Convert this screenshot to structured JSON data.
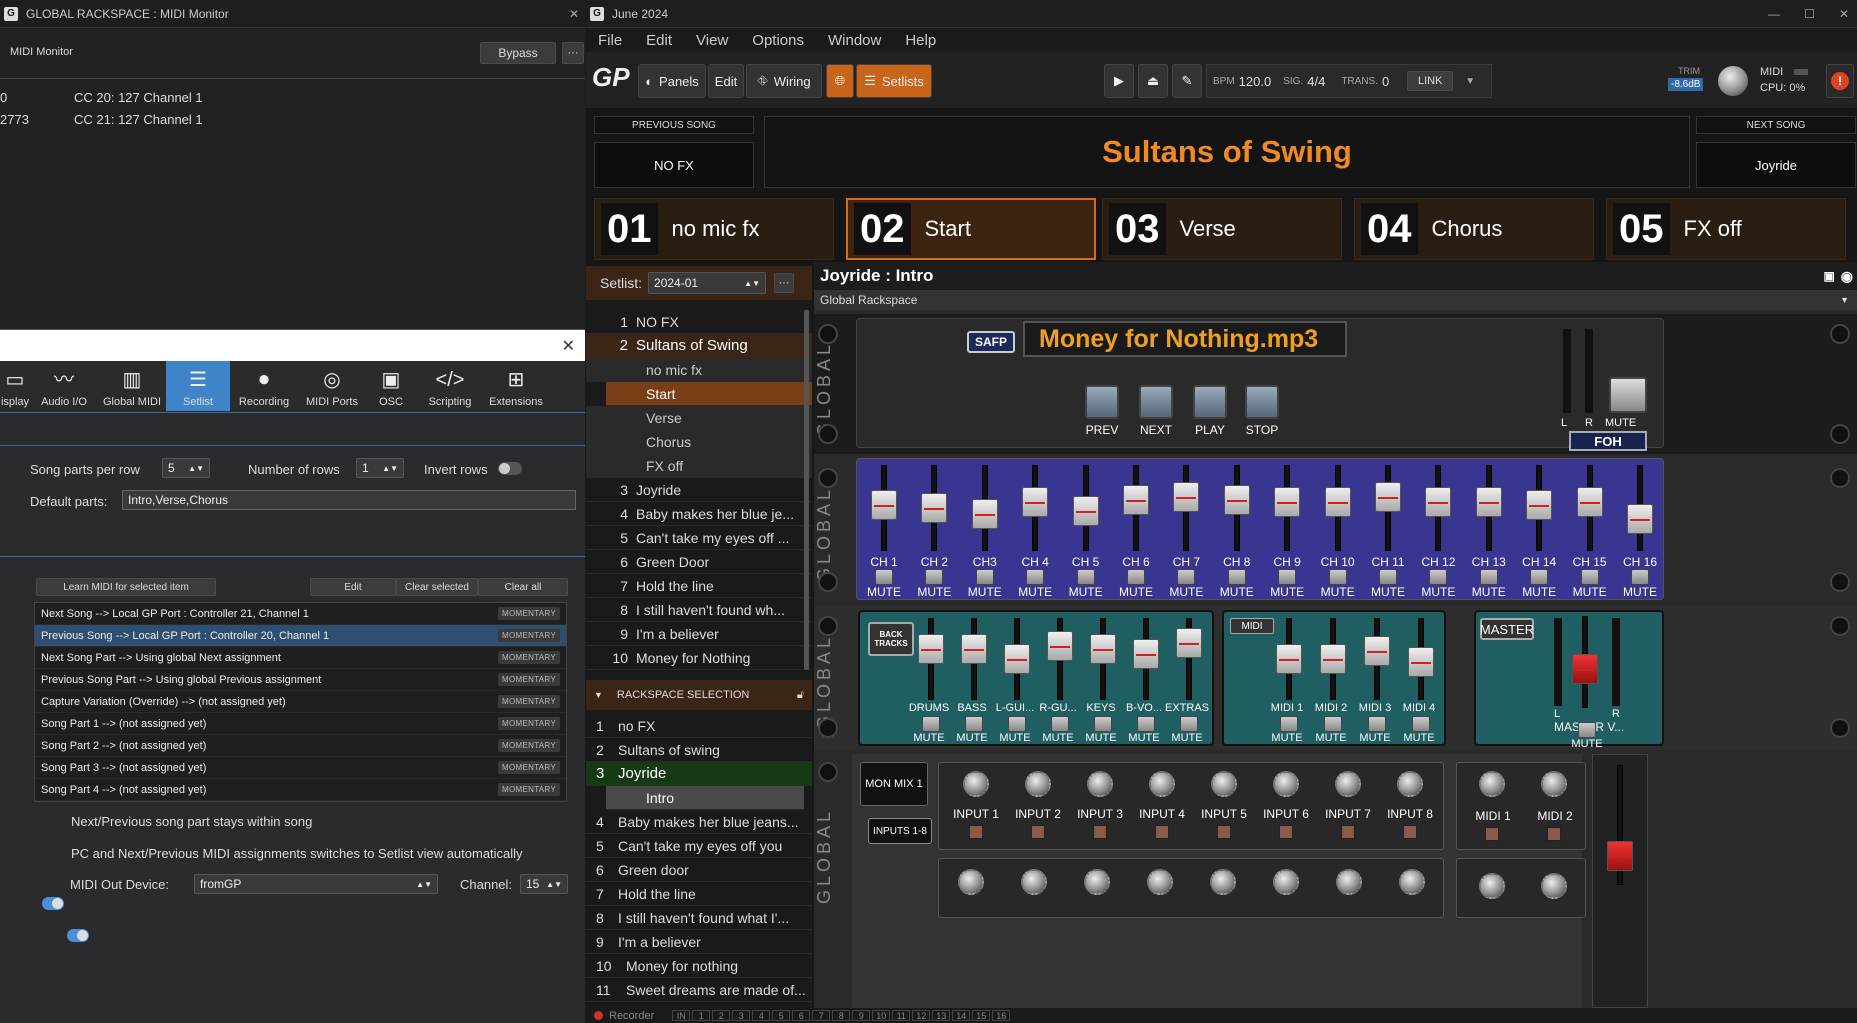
{
  "midi_monitor": {
    "window_title": "GLOBAL RACKSPACE : MIDI Monitor",
    "header": "MIDI Monitor",
    "bypass": "Bypass",
    "more": "···",
    "events": [
      {
        "time": "0",
        "msg": "CC 20: 127 Channel 1"
      },
      {
        "time": "2773",
        "msg": "CC 21: 127 Channel 1"
      }
    ]
  },
  "options": {
    "close": "✕",
    "tabs": [
      {
        "label": "isplay",
        "icon": "display-icon"
      },
      {
        "label": "Audio I/O",
        "icon": "waveform-icon"
      },
      {
        "label": "Global MIDI",
        "icon": "piano-icon"
      },
      {
        "label": "Setlist",
        "icon": "list-icon"
      },
      {
        "label": "Recording",
        "icon": "rec-icon"
      },
      {
        "label": "MIDI Ports",
        "icon": "midi-port-icon"
      },
      {
        "label": "OSC",
        "icon": "osc-icon"
      },
      {
        "label": "Scripting",
        "icon": "code-icon"
      },
      {
        "label": "Extensions",
        "icon": "plus-icon"
      }
    ],
    "active_tab": "Setlist",
    "song_parts_per_row_label": "Song parts per row",
    "song_parts_per_row": "5",
    "number_of_rows_label": "Number of rows",
    "number_of_rows": "1",
    "invert_rows_label": "Invert rows",
    "default_parts_label": "Default parts:",
    "default_parts": "Intro,Verse,Chorus",
    "learn_btn": "Learn MIDI for selected item",
    "edit_btn": "Edit",
    "clear_selected_btn": "Clear selected",
    "clear_all_btn": "Clear all",
    "assignments": [
      {
        "text": "Next Song --> Local GP Port : Controller 21, Channel 1",
        "mode": "MOMENTARY"
      },
      {
        "text": "Previous Song --> Local GP Port : Controller 20, Channel 1",
        "mode": "MOMENTARY"
      },
      {
        "text": "Next Song Part --> Using global Next assignment",
        "mode": "MOMENTARY"
      },
      {
        "text": "Previous Song Part --> Using global Previous assignment",
        "mode": "MOMENTARY"
      },
      {
        "text": "Capture Variation (Override) --> (not assigned yet)",
        "mode": "MOMENTARY"
      },
      {
        "text": "Song Part 1 --> (not assigned yet)",
        "mode": "MOMENTARY"
      },
      {
        "text": "Song Part 2 --> (not assigned yet)",
        "mode": "MOMENTARY"
      },
      {
        "text": "Song Part 3 --> (not assigned yet)",
        "mode": "MOMENTARY"
      },
      {
        "text": "Song Part 4 --> (not assigned yet)",
        "mode": "MOMENTARY"
      }
    ],
    "toggle1": "Next/Previous song part stays within song",
    "toggle2": "PC and Next/Previous MIDI assignments switches to Setlist view automatically",
    "midi_out_label": "MIDI Out Device:",
    "midi_out": "fromGP",
    "channel_label": "Channel:",
    "channel": "15"
  },
  "gp": {
    "window_title": "June 2024",
    "menu": [
      "File",
      "Edit",
      "View",
      "Options",
      "Window",
      "Help"
    ],
    "toolbar": {
      "panels": "Panels",
      "edit": "Edit",
      "wiring": "Wiring",
      "setlists": "Setlists",
      "bpm_label": "BPM",
      "bpm": "120.0",
      "sig_label": "SIG.",
      "sig": "4/4",
      "trans_label": "TRANS.",
      "trans": "0",
      "link": "LINK",
      "trim_label": "TRIM",
      "trim": "-8.6dB",
      "midi_label": "MIDI",
      "cpu": "CPU: 0%"
    },
    "prev_song_label": "PREVIOUS SONG",
    "prev_song": "NO FX",
    "current_song": "Sultans of Swing",
    "next_song_label": "NEXT SONG",
    "next_song": "Joyride",
    "parts": [
      {
        "num": "01",
        "name": "no mic fx"
      },
      {
        "num": "02",
        "name": "Start"
      },
      {
        "num": "03",
        "name": "Verse"
      },
      {
        "num": "04",
        "name": "Chorus"
      },
      {
        "num": "05",
        "name": "FX off"
      }
    ],
    "active_part": "02",
    "setlist_label": "Setlist:",
    "setlist": "2024-01",
    "songs": [
      {
        "n": "1",
        "t": "NO FX"
      },
      {
        "n": "2",
        "t": "Sultans of Swing",
        "sub": [
          "no mic fx",
          "Start",
          "Verse",
          "Chorus",
          "FX off"
        ]
      },
      {
        "n": "3",
        "t": "Joyride"
      },
      {
        "n": "4",
        "t": "Baby makes her blue je..."
      },
      {
        "n": "5",
        "t": "Can't take my eyes off ..."
      },
      {
        "n": "6",
        "t": "Green Door"
      },
      {
        "n": "7",
        "t": "Hold the line"
      },
      {
        "n": "8",
        "t": "I still haven't found wh..."
      },
      {
        "n": "9",
        "t": "I'm a believer"
      },
      {
        "n": "10",
        "t": "Money for Nothing"
      }
    ],
    "rackspace_label": "RACKSPACE SELECTION",
    "rackspaces": [
      {
        "n": "1",
        "t": "no FX"
      },
      {
        "n": "2",
        "t": "Sultans of swing"
      },
      {
        "n": "3",
        "t": "Joyride",
        "sub": "Intro"
      },
      {
        "n": "4",
        "t": "Baby makes her blue jeans..."
      },
      {
        "n": "5",
        "t": "Can't take my eyes off you"
      },
      {
        "n": "6",
        "t": "Green door"
      },
      {
        "n": "7",
        "t": "Hold the line"
      },
      {
        "n": "8",
        "t": "I still haven't found what I'..."
      },
      {
        "n": "9",
        "t": "I'm a believer"
      },
      {
        "n": "10",
        "t": "Money for nothing"
      },
      {
        "n": "11",
        "t": "Sweet dreams are made of..."
      }
    ],
    "rack_title": "Joyride : Intro",
    "global_rackspace": "Global Rackspace",
    "global_vert": "GLOBAL",
    "safp": "SAFP",
    "track": "Money for Nothing.mp3",
    "transport": [
      "PREV",
      "NEXT",
      "PLAY",
      "STOP"
    ],
    "foh": "FOH",
    "mute": "MUTE",
    "l": "L",
    "r": "R",
    "channels": [
      "CH 1",
      "CH 2",
      "CH3",
      "CH 4",
      "CH 5",
      "CH 6",
      "CH 7",
      "CH 8",
      "CH 9",
      "CH 10",
      "CH 11",
      "CH 12",
      "CH 13",
      "CH 14",
      "CH 15",
      "CH 16"
    ],
    "channel_levels": [
      0.55,
      0.5,
      0.4,
      0.6,
      0.45,
      0.65,
      0.7,
      0.65,
      0.6,
      0.6,
      0.7,
      0.6,
      0.6,
      0.55,
      0.6,
      0.3
    ],
    "back_tracks": "BACK TRACKS",
    "stems": [
      "DRUMS",
      "BASS",
      "L-GUI...",
      "R-GU...",
      "KEYS",
      "B-VO...",
      "EXTRAS"
    ],
    "stem_levels": [
      0.7,
      0.7,
      0.5,
      0.75,
      0.7,
      0.6,
      0.8
    ],
    "midi_box": "MIDI",
    "midi_ch": [
      "MIDI 1",
      "MIDI 2",
      "MIDI 3",
      "MIDI 4"
    ],
    "midi_levels": [
      0.5,
      0.5,
      0.65,
      0.45
    ],
    "master": "MASTER",
    "master_vol": "MASTER V...",
    "mon_mix": "MON MIX 1",
    "inputs_btn": "INPUTS 1-8",
    "inputs": [
      "INPUT 1",
      "INPUT 2",
      "INPUT 3",
      "INPUT 4",
      "INPUT 5",
      "INPUT 6",
      "INPUT 7",
      "INPUT 8"
    ],
    "mon_midi": [
      "MIDI 1",
      "MIDI 2"
    ],
    "recorder": "Recorder",
    "footer_nums": [
      "IN",
      "1",
      "2",
      "3",
      "4",
      "5",
      "6",
      "7",
      "8",
      "9",
      "10",
      "11",
      "12",
      "13",
      "14",
      "15",
      "16"
    ]
  }
}
